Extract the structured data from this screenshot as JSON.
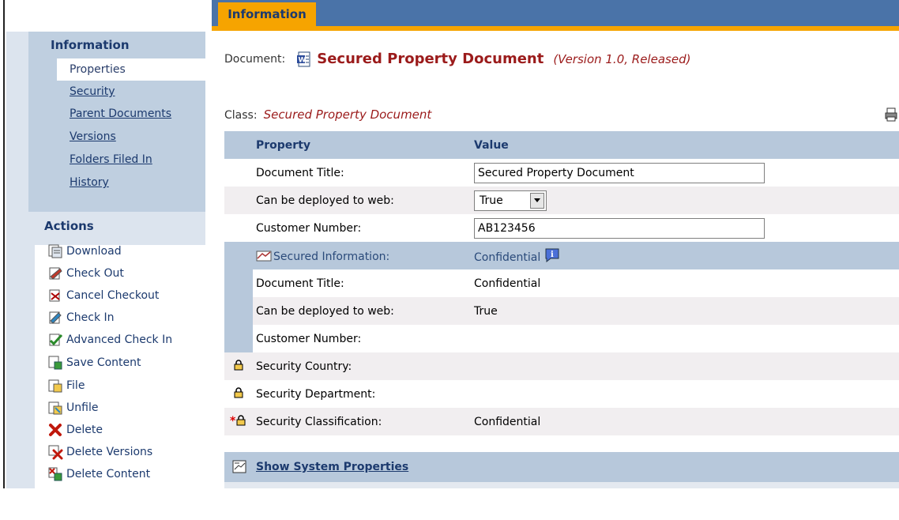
{
  "header": {
    "tab_label": "Information"
  },
  "sidebar": {
    "info_heading": "Information",
    "nav": [
      {
        "label": "Properties",
        "active": true
      },
      {
        "label": "Security"
      },
      {
        "label": "Parent Documents"
      },
      {
        "label": "Versions"
      },
      {
        "label": "Folders Filed In"
      },
      {
        "label": "History"
      }
    ],
    "actions_heading": "Actions",
    "actions": [
      {
        "label": "Download",
        "icon": "download-icon"
      },
      {
        "label": "Check Out",
        "icon": "check-out-icon"
      },
      {
        "label": "Cancel Checkout",
        "icon": "cancel-checkout-icon"
      },
      {
        "label": "Check In",
        "icon": "check-in-icon"
      },
      {
        "label": "Advanced Check In",
        "icon": "advanced-check-in-icon"
      },
      {
        "label": "Save Content",
        "icon": "save-content-icon"
      },
      {
        "label": "File",
        "icon": "file-icon"
      },
      {
        "label": "Unfile",
        "icon": "unfile-icon"
      },
      {
        "label": "Delete",
        "icon": "delete-icon"
      },
      {
        "label": "Delete Versions",
        "icon": "delete-versions-icon"
      },
      {
        "label": "Delete Content",
        "icon": "delete-content-icon"
      }
    ]
  },
  "document": {
    "label": "Document:",
    "title": "Secured Property Document",
    "version": "(Version 1.0, Released)"
  },
  "class": {
    "label": "Class:",
    "value": "Secured Property Document"
  },
  "table": {
    "header_property": "Property",
    "header_value": "Value",
    "rows": {
      "doc_title_label": "Document Title:",
      "doc_title_value": "Secured Property Document",
      "deploy_label": "Can be deployed to web:",
      "deploy_value": "True",
      "customer_label": "Customer Number:",
      "customer_value": "AB123456",
      "secured_label": "Secured Information:",
      "secured_value": "Confidential",
      "sub_doc_title_label": "Document Title:",
      "sub_doc_title_value": "Confidential",
      "sub_deploy_label": "Can be deployed to web:",
      "sub_deploy_value": "True",
      "sub_customer_label": "Customer Number:",
      "sub_customer_value": "",
      "sec_country_label": "Security Country:",
      "sec_country_value": "",
      "sec_dept_label": "Security Department:",
      "sec_dept_value": "",
      "sec_class_label": "Security Classification:",
      "sec_class_value": "Confidential"
    }
  },
  "footer": {
    "show_system_properties": "Show System Properties"
  },
  "colors": {
    "accent_orange": "#f6a400",
    "header_blue": "#4a73a8",
    "title_red": "#9b1b1b",
    "row_blue": "#b7c8db"
  }
}
